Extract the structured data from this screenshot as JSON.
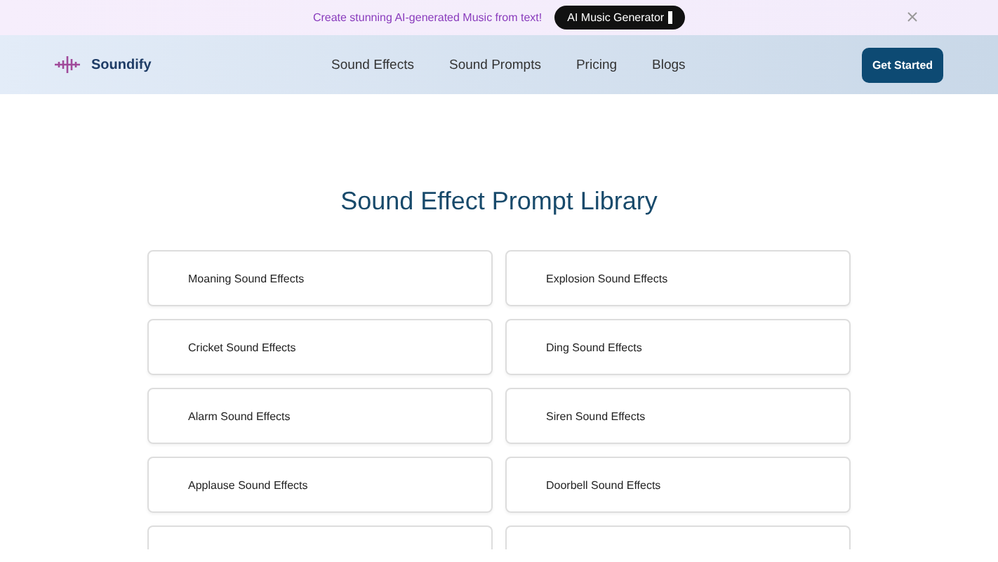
{
  "banner": {
    "message": "Create stunning AI-generated Music from text!",
    "button": "AI Music Generator"
  },
  "nav": {
    "brand": "Soundify",
    "links": [
      "Sound Effects",
      "Sound Prompts",
      "Pricing",
      "Blogs"
    ],
    "cta": "Get Started"
  },
  "title": "Sound Effect Prompt Library",
  "cards": [
    {
      "label": "Moaning Sound Effects"
    },
    {
      "label": "Explosion Sound Effects"
    },
    {
      "label": "Cricket Sound Effects"
    },
    {
      "label": "Ding Sound Effects"
    },
    {
      "label": "Alarm Sound Effects"
    },
    {
      "label": "Siren Sound Effects"
    },
    {
      "label": "Applause Sound Effects"
    },
    {
      "label": "Doorbell Sound Effects"
    }
  ]
}
